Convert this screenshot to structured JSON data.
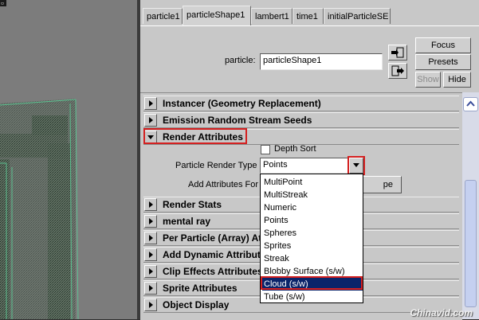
{
  "viewport": {
    "corner_glyph": "▫"
  },
  "tabs": [
    {
      "label": "particle1"
    },
    {
      "label": "particleShape1"
    },
    {
      "label": "lambert1"
    },
    {
      "label": "time1"
    },
    {
      "label": "initialParticleSE"
    }
  ],
  "active_tab": "particleShape1",
  "header": {
    "node_label": "particle:",
    "node_value": "particleShape1",
    "focus": "Focus",
    "presets": "Presets",
    "show": "Show",
    "hide": "Hide"
  },
  "sections": {
    "instancer": "Instancer (Geometry Replacement)",
    "emission": "Emission Random Stream Seeds",
    "render_attributes": "Render Attributes",
    "render_stats": "Render Stats",
    "mental_ray": "mental ray",
    "per_particle": "Per Particle (Array) At",
    "add_dynamic": "Add Dynamic Attribute",
    "clip_effects": "Clip Effects Attributes",
    "sprite": "Sprite Attributes",
    "object_display": "Object Display"
  },
  "render": {
    "depth_sort_label": "Depth Sort",
    "render_type_label": "Particle Render Type",
    "render_type_value": "Points",
    "add_attr_label": "Add Attributes For",
    "add_attr_button_tail": "pe"
  },
  "dropdown_options": [
    "MultiPoint",
    "MultiStreak",
    "Numeric",
    "Points",
    "Spheres",
    "Sprites",
    "Streak",
    "Blobby Surface (s/w)",
    "Cloud (s/w)",
    "Tube (s/w)"
  ],
  "dropdown_selected": "Cloud (s/w)",
  "watermark": "Chinavid.com",
  "colors": {
    "highlight": "#0a246a",
    "annotation": "#d42020",
    "panel": "#c8c8c8"
  }
}
